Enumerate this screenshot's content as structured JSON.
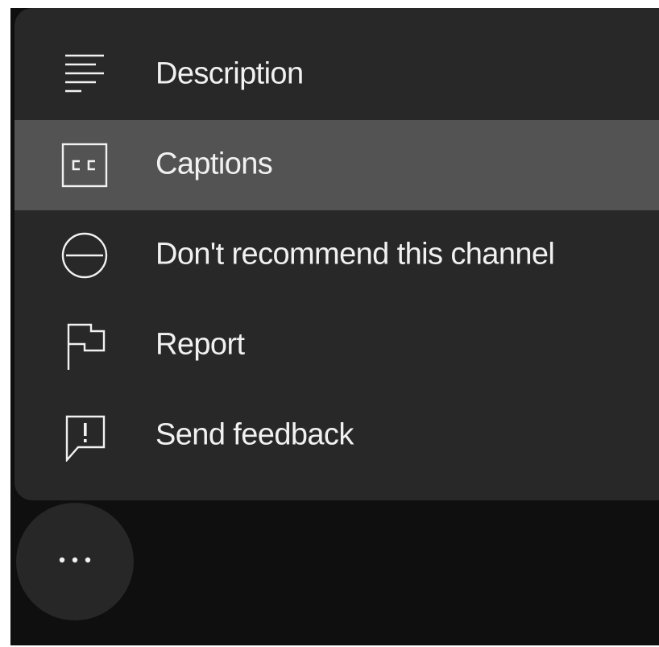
{
  "menu": {
    "items": [
      {
        "label": "Description",
        "icon": "description-icon"
      },
      {
        "label": "Captions",
        "icon": "captions-icon",
        "highlighted": true
      },
      {
        "label": "Don't recommend this channel",
        "icon": "block-icon"
      },
      {
        "label": "Report",
        "icon": "flag-icon"
      },
      {
        "label": "Send feedback",
        "icon": "feedback-icon"
      }
    ]
  },
  "more_button": {
    "icon": "more-horizontal-icon"
  },
  "colors": {
    "background": "#0f0f0f",
    "menu_background": "#282828",
    "highlight": "#535353",
    "text": "#f1f1f1"
  }
}
